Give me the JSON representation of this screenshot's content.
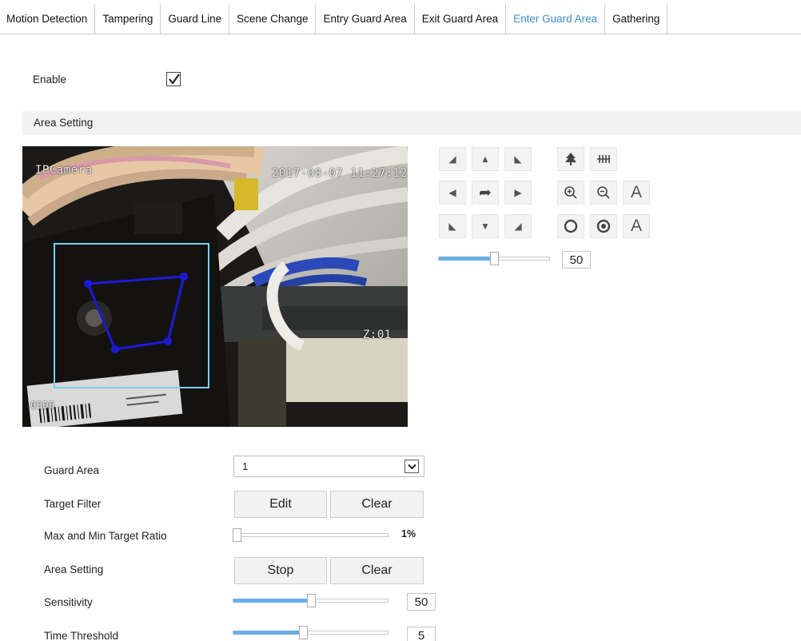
{
  "tabs": [
    {
      "label": "Motion Detection",
      "active": false
    },
    {
      "label": "Tampering",
      "active": false
    },
    {
      "label": "Guard Line",
      "active": false
    },
    {
      "label": "Scene Change",
      "active": false
    },
    {
      "label": "Entry Guard Area",
      "active": false
    },
    {
      "label": "Exit Guard Area",
      "active": false
    },
    {
      "label": "Enter Guard Area",
      "active": true
    },
    {
      "label": "Gathering",
      "active": false
    }
  ],
  "enable": {
    "label": "Enable",
    "checked": true
  },
  "section": {
    "title": "Area Setting"
  },
  "video": {
    "camera_name": "IPCamera",
    "timestamp": "2017-08-07 11:27:12",
    "zoom_text": "Z:01",
    "label_code": "0SD6"
  },
  "ptz": {
    "speed_value": "50",
    "speed_fraction": 0.5,
    "icons": [
      "up-left-arrow-icon",
      "up-arrow-icon",
      "up-right-arrow-icon",
      "left-arrow-icon",
      "auto-pan-icon",
      "right-arrow-icon",
      "down-left-arrow-icon",
      "down-arrow-icon",
      "down-right-arrow-icon",
      "wiper-icon",
      "heater-icon",
      "zoom-in-icon",
      "zoom-out-icon",
      "focus-near-icon",
      "focus-far-icon",
      "iris-open-icon",
      "iris-close-icon"
    ],
    "focus_label": "A",
    "iris_label": "A"
  },
  "form": {
    "guard_area": {
      "label": "Guard Area",
      "value": "1"
    },
    "target_filter": {
      "label": "Target Filter",
      "edit": "Edit",
      "clear": "Clear"
    },
    "ratio": {
      "label": "Max and Min Target Ratio",
      "value": "1%",
      "fraction": 0.01
    },
    "area_setting": {
      "label": "Area Setting",
      "stop": "Stop",
      "clear": "Clear"
    },
    "sensitivity": {
      "label": "Sensitivity",
      "value": "50",
      "fraction": 0.5
    },
    "time_threshold": {
      "label": "Time Threshold",
      "value": "5",
      "fraction": 0.45
    }
  },
  "colors": {
    "accent": "#3a8fd0",
    "slider_fill": "#6aaee3",
    "area_outline": "#1a1ad6",
    "guard_rect": "#7ad0ea"
  }
}
